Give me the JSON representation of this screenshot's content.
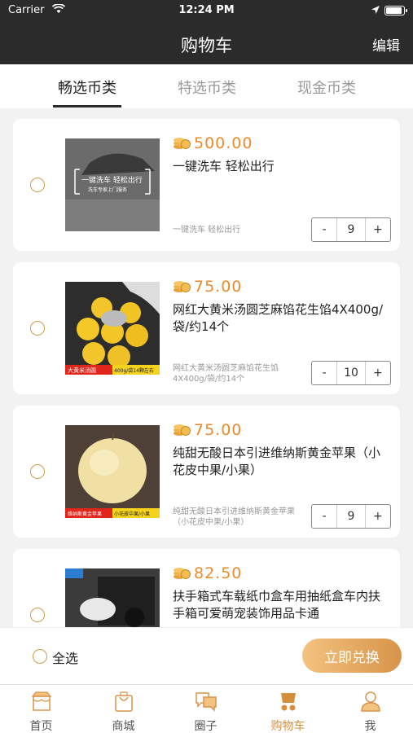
{
  "status": {
    "carrier": "Carrier",
    "time": "12:24 PM"
  },
  "nav": {
    "title": "购物车",
    "edit": "编辑"
  },
  "tabs": [
    {
      "label": "畅选币类",
      "active": true
    },
    {
      "label": "特选币类",
      "active": false
    },
    {
      "label": "现金币类",
      "active": false
    }
  ],
  "items": [
    {
      "price": "500.00",
      "title": "一键洗车 轻松出行",
      "subtitle": "一键洗车 轻松出行",
      "qty": "9",
      "thumb_text": {
        "main": "一键洗车  轻松出行",
        "sub": "洗车专家上门服务"
      }
    },
    {
      "price": "75.00",
      "title": "网红大黄米汤圆芝麻馅花生馅4X400g/袋/约14个",
      "subtitle": "网红大黄米汤圆芝麻馅花生馅4X400g/袋/约14个",
      "qty": "10",
      "thumb_text": {
        "left": "大黄米汤圆",
        "right": "400g/袋14颗左右"
      }
    },
    {
      "price": "75.00",
      "title": "纯甜无酸日本引进维纳斯黄金苹果（小花皮中果/小果）",
      "subtitle": "纯甜无酸日本引进维纳斯黄金苹果（小花皮中果/小果）",
      "qty": "9",
      "thumb_text": {
        "left": "维纳斯黄金苹果",
        "right": "小花皮中果/小果"
      }
    },
    {
      "price": "82.50",
      "title": "扶手箱式车载纸巾盒车用抽纸盒车内扶手箱可爱萌宠装饰用品卡通",
      "subtitle": "",
      "qty": "",
      "thumb_text": {}
    }
  ],
  "footer": {
    "select_all": "全选",
    "redeem": "立即兑换"
  },
  "tabbar": [
    {
      "label": "首页",
      "icon": "home-icon"
    },
    {
      "label": "商城",
      "icon": "shopping-bag-icon"
    },
    {
      "label": "圈子",
      "icon": "chat-bubbles-icon"
    },
    {
      "label": "购物车",
      "icon": "cart-icon",
      "active": true
    },
    {
      "label": "我",
      "icon": "user-icon"
    }
  ],
  "colors": {
    "accent": "#EE8A2A",
    "dark": "#2B2B2B",
    "button_gradient": [
      "#F3C37F",
      "#D8944A"
    ]
  }
}
